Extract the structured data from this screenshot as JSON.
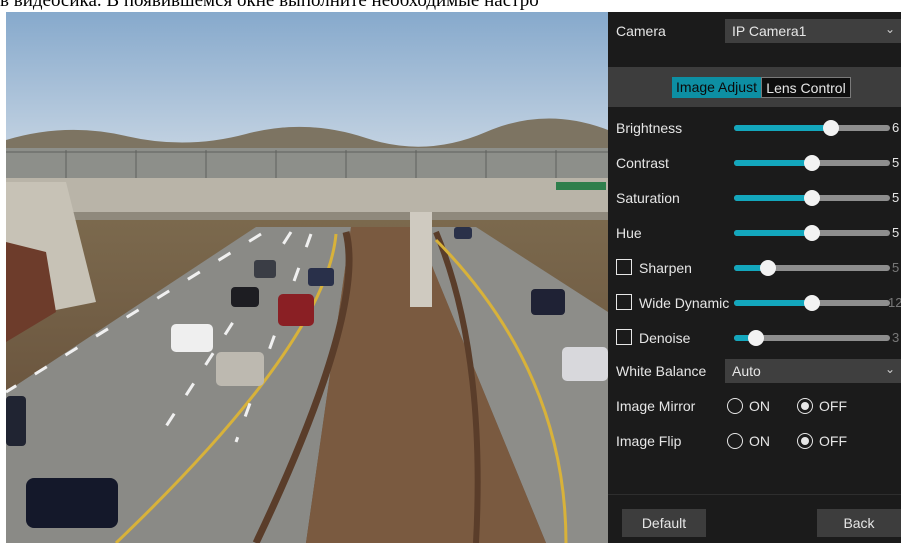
{
  "caption": "в видеосика. В появившемся окне выполните необходимые настро",
  "camera": {
    "label": "Camera",
    "value": "IP Camera1"
  },
  "tabs": [
    {
      "label": "Image Adjust",
      "active": true
    },
    {
      "label": "Lens Control",
      "active": false
    }
  ],
  "sliders": {
    "brightness": {
      "label": "Brightness",
      "value": "6",
      "level": 0.62,
      "enabled": true
    },
    "contrast": {
      "label": "Contrast",
      "value": "5",
      "level": 0.5,
      "enabled": true
    },
    "saturation": {
      "label": "Saturation",
      "value": "5",
      "level": 0.5,
      "enabled": true
    },
    "hue": {
      "label": "Hue",
      "value": "5",
      "level": 0.5,
      "enabled": true
    }
  },
  "toggles": {
    "sharpen": {
      "label": "Sharpen",
      "value": "5",
      "level": 0.22,
      "checked": false
    },
    "wide_dynamic": {
      "label": "Wide Dynamic",
      "value": "12",
      "level": 0.5,
      "checked": false
    },
    "denoise": {
      "label": "Denoise",
      "value": "3",
      "level": 0.14,
      "checked": false
    }
  },
  "white_balance": {
    "label": "White Balance",
    "value": "Auto"
  },
  "image_mirror": {
    "label": "Image Mirror",
    "on_label": "ON",
    "off_label": "OFF",
    "selected": "OFF"
  },
  "image_flip": {
    "label": "Image Flip",
    "on_label": "ON",
    "off_label": "OFF",
    "selected": "OFF"
  },
  "buttons": {
    "default": "Default",
    "back": "Back"
  },
  "colors": {
    "accent": "#13a7bd",
    "tab_active": "#0d8fa3",
    "panel_bg": "#1b1b1b"
  }
}
